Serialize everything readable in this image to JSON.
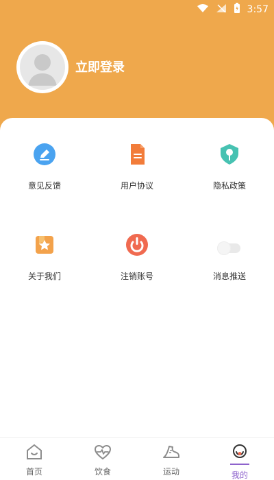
{
  "status": {
    "time": "3:57"
  },
  "header": {
    "login_label": "立即登录"
  },
  "grid": {
    "items": [
      {
        "label": "意见反馈",
        "icon": "edit-icon",
        "color": "#4AA3F0"
      },
      {
        "label": "用户协议",
        "icon": "document-icon",
        "color": "#F27C3A"
      },
      {
        "label": "隐私政策",
        "icon": "shield-icon",
        "color": "#47C2B2"
      },
      {
        "label": "关于我们",
        "icon": "star-icon",
        "color": "#F3A24B"
      },
      {
        "label": "注销账号",
        "icon": "power-icon",
        "color": "#F06A50"
      },
      {
        "label": "消息推送",
        "icon": "toggle-icon",
        "state": "off"
      }
    ]
  },
  "nav": {
    "items": [
      {
        "label": "首页",
        "icon": "home-icon"
      },
      {
        "label": "饮食",
        "icon": "heart-icon"
      },
      {
        "label": "运动",
        "icon": "shoe-icon"
      },
      {
        "label": "我的",
        "icon": "profile-icon",
        "active": true
      }
    ]
  },
  "colors": {
    "header_bg": "#EFA84C",
    "active_nav": "#8E63CC",
    "text_primary": "#333333"
  }
}
